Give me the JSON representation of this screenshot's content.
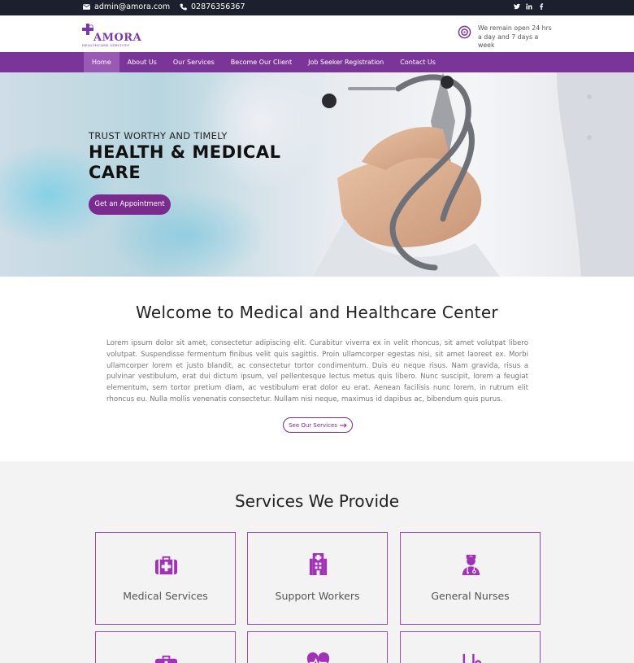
{
  "topbar": {
    "email": "admin@amora.com",
    "phone": "02876356367",
    "social_icons": [
      "twitter-icon",
      "linkedin-icon",
      "facebook-icon"
    ]
  },
  "header": {
    "logo_name": "AMORA",
    "logo_tagline": "HEALTHCARE SERVICES",
    "hours_text": "We remain open 24 hrs a day and 7 days a week"
  },
  "nav": {
    "items": [
      "Home",
      "About Us",
      "Our Services",
      "Become Our Client",
      "Job Seeker Registration",
      "Contact Us"
    ],
    "active": "Home"
  },
  "hero": {
    "tagline": "TRUST WORTHY AND TIMELY",
    "headline": "HEALTH & MEDICAL CARE",
    "cta_label": "Get an Appointment"
  },
  "welcome": {
    "title": "Welcome to Medical and Healthcare Center",
    "body": "Lorem ipsum dolor sit amet, consectetur adipiscing elit. Curabitur viverra ex in velit rhoncus, sit amet volutpat libero volutpat. Suspendisse fermentum finibus velit quis sagittis. Proin ullamcorper egestas nisi, sit amet laoreet ex. Morbi ullamcorper lorem et justo blandit, ac consectetur tortor condimentum. Duis eu neque risus. Nam gravida, risus a pulvinar vestibulum, erat dui dictum ipsum, vel pellentesque lectus metus quis libero. Nunc suscipit, lorem a feugiat elementum, sem tortor pretium diam, ac vestibulum erat dolor eu erat. Aenean facilisis nunc lorem, in rutrum elit rhoncus eu. Nulla mollis venenatis consectetur. Nullam nisi neque, maximus id dapibus ac, bibendum quis purus.",
    "button_label": "See Our Services"
  },
  "services": {
    "title": "Services We Provide",
    "cards": [
      {
        "label": "Medical Services",
        "icon": "medical-kit-icon"
      },
      {
        "label": "Support Workers",
        "icon": "hospital-building-icon"
      },
      {
        "label": "General Nurses",
        "icon": "nurse-icon"
      },
      {
        "label": "",
        "icon": "medical-cross-icon"
      },
      {
        "label": "",
        "icon": "heartbeat-icon"
      },
      {
        "label": "",
        "icon": "stethoscope-icon"
      }
    ]
  },
  "colors": {
    "brand_purple": "#7b3598",
    "button_purple": "#7b2a8e",
    "topbar_dark": "#1c1f2e"
  }
}
